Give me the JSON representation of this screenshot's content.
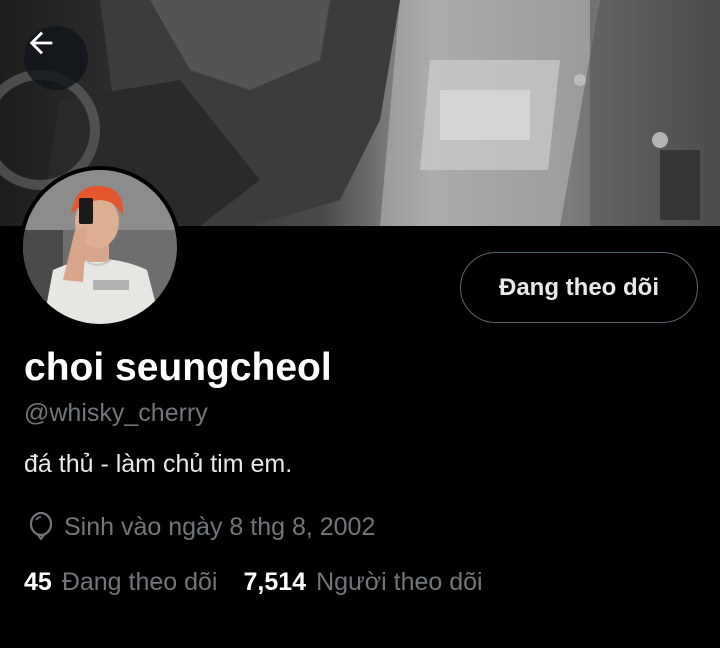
{
  "header": {
    "back_icon": "arrow-left-icon",
    "banner": "grayscale photo banner"
  },
  "profile": {
    "display_name": "choi seungcheol",
    "handle": "@whisky_cherry",
    "bio": "đá thủ - làm chủ tim em.",
    "birthday": "Sinh vào ngày 8 thg 8, 2002",
    "birthday_icon": "balloon-icon",
    "follow_button_label": "Đang theo dõi"
  },
  "stats": {
    "following_count": "45",
    "following_label": "Đang theo dõi",
    "followers_count": "7,514",
    "followers_label": "Người theo dõi"
  },
  "colors": {
    "background": "#000000",
    "primary_text": "#e7e9ea",
    "secondary_text": "#71767b",
    "border": "#536471"
  }
}
